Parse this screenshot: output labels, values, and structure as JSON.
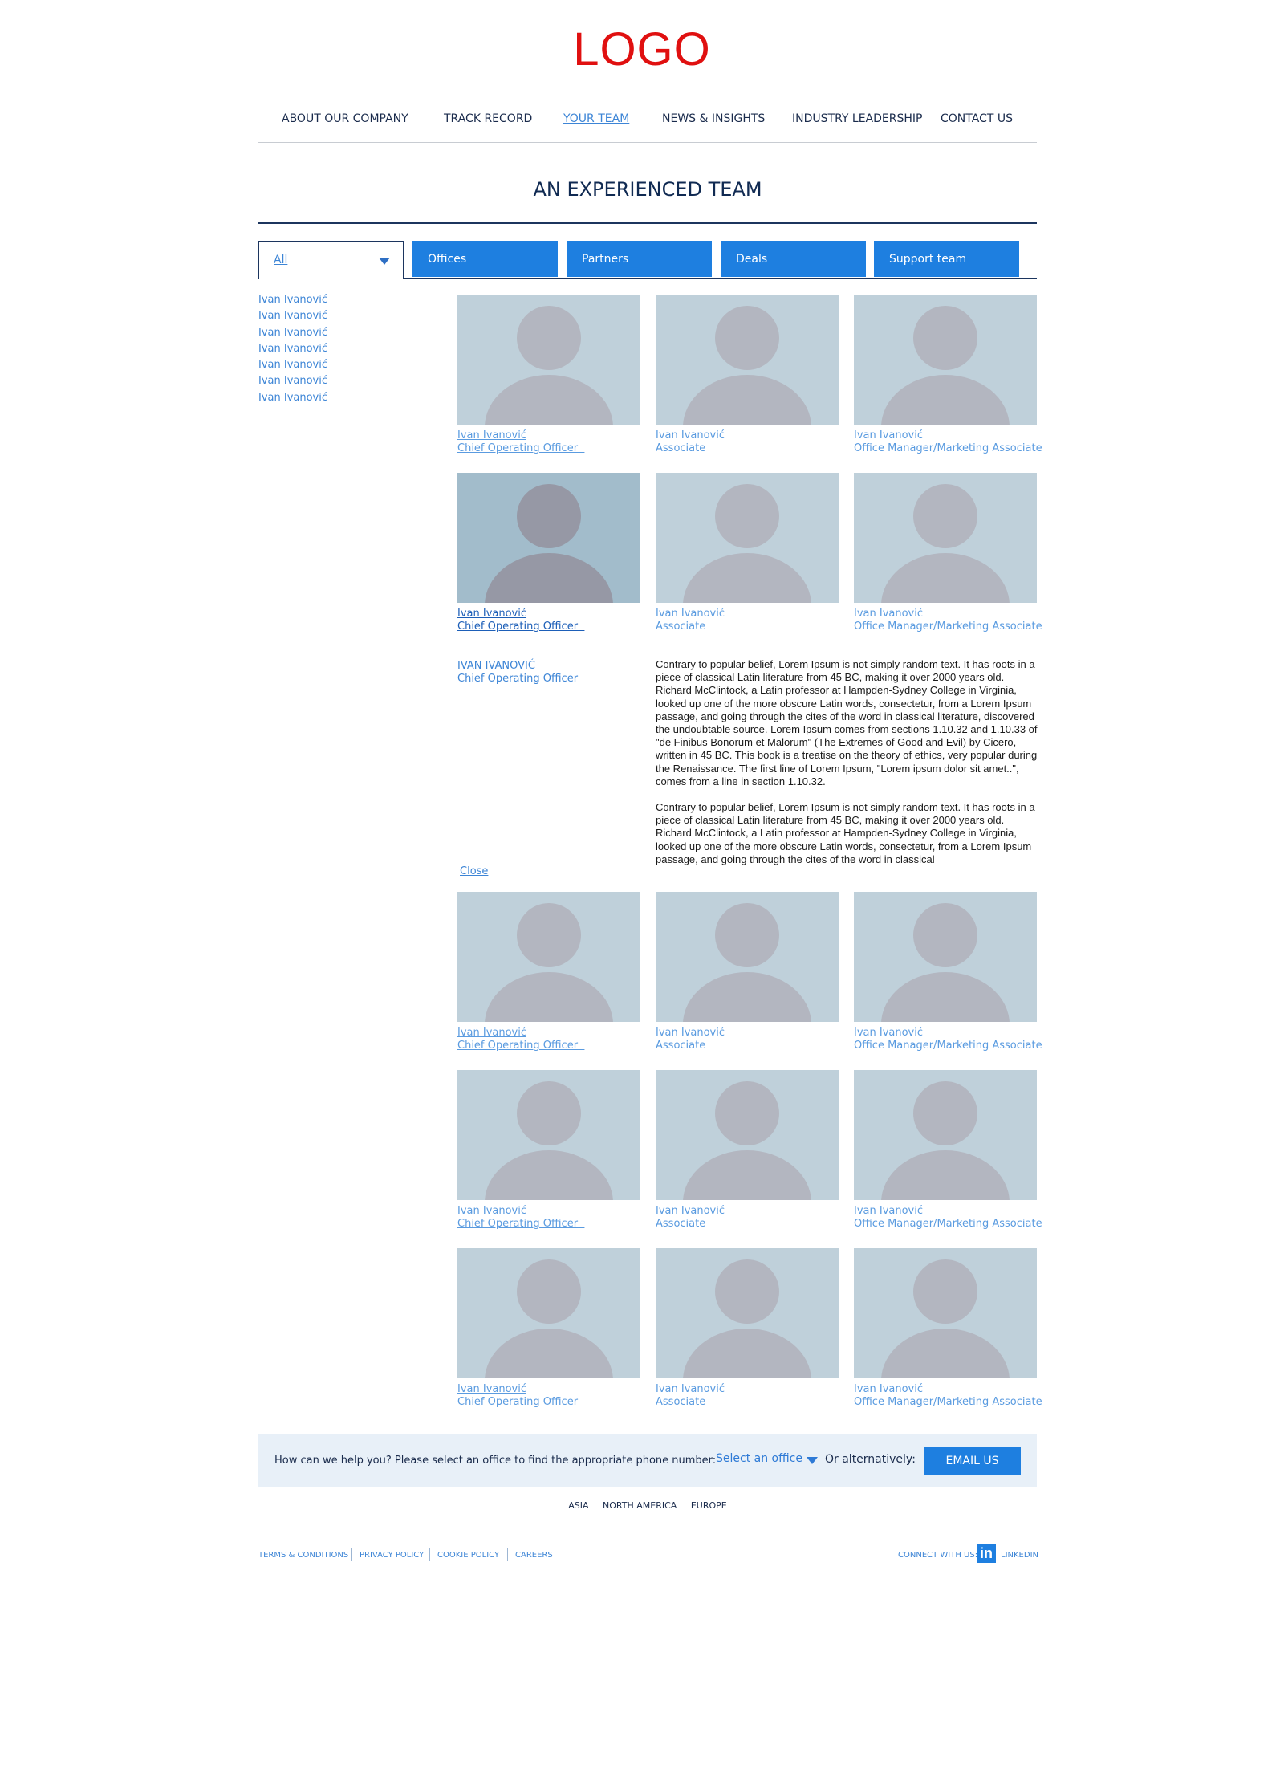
{
  "header": {
    "logo": "LOGO"
  },
  "nav": {
    "items": [
      "ABOUT OUR COMPANY",
      "TRACK RECORD",
      "YOUR TEAM",
      "NEWS & INSIGHTS",
      "INDUSTRY LEADERSHIP",
      "CONTACT US"
    ],
    "active": "YOUR TEAM"
  },
  "page": {
    "title": "AN EXPERIENCED TEAM"
  },
  "filters": {
    "dropdown": {
      "selected": "All"
    },
    "tabs": [
      "Offices",
      "Partners",
      "Deals",
      "Support team"
    ]
  },
  "sidebar": {
    "links": [
      "Ivan Ivanović",
      "Ivan Ivanović",
      "Ivan Ivanović",
      "Ivan Ivanović",
      "Ivan Ivanović",
      "Ivan Ivanović",
      "Ivan Ivanović"
    ]
  },
  "team": {
    "rows": [
      [
        {
          "name": "Ivan Ivanović",
          "role": "Chief Operating Officer"
        },
        {
          "name": "Ivan Ivanović",
          "role": "Associate"
        },
        {
          "name": "Ivan Ivanović",
          "role": "Office Manager/Marketing Associate"
        }
      ],
      [
        {
          "name": "Ivan Ivanović",
          "role": "Chief Operating Officer"
        },
        {
          "name": "Ivan Ivanović",
          "role": "Associate"
        },
        {
          "name": "Ivan Ivanović",
          "role": "Office Manager/Marketing Associate"
        }
      ],
      [
        {
          "name": "Ivan Ivanović",
          "role": "Chief Operating Officer"
        },
        {
          "name": "Ivan Ivanović",
          "role": "Associate"
        },
        {
          "name": "Ivan Ivanović",
          "role": "Office Manager/Marketing Associate"
        }
      ],
      [
        {
          "name": "Ivan Ivanović",
          "role": "Chief Operating Officer"
        },
        {
          "name": "Ivan Ivanović",
          "role": "Associate"
        },
        {
          "name": "Ivan Ivanović",
          "role": "Office Manager/Marketing Associate"
        }
      ],
      [
        {
          "name": "Ivan Ivanović",
          "role": "Chief Operating Officer"
        },
        {
          "name": "Ivan Ivanović",
          "role": "Associate"
        },
        {
          "name": "Ivan Ivanović",
          "role": "Office Manager/Marketing Associate"
        }
      ]
    ]
  },
  "detail": {
    "name": "IVAN IVANOVIĆ",
    "role": "Chief Operating Officer",
    "close_label": "Close",
    "bio": [
      "Contrary to popular belief, Lorem Ipsum is not simply random text. It has roots in a piece of classical Latin literature from 45 BC, making it over 2000 years old. Richard McClintock, a Latin professor at Hampden-Sydney College in Virginia, looked up one of the more obscure Latin words, consectetur, from a Lorem Ipsum passage, and going through the cites of the word in classical literature, discovered the undoubtable source. Lorem Ipsum comes from sections 1.10.32 and 1.10.33 of \"de Finibus Bonorum et Malorum\" (The Extremes of Good and Evil) by Cicero, written in 45 BC. This book is a treatise on the theory of ethics, very popular during the Renaissance. The first line of Lorem Ipsum, \"Lorem ipsum dolor sit amet..\", comes from a line in section 1.10.32.",
      "Contrary to popular belief, Lorem Ipsum is not simply random text. It has roots in a piece of classical Latin literature from 45 BC, making it over 2000 years old. Richard McClintock, a Latin professor at Hampden-Sydney College in Virginia, looked up one of the more obscure Latin words, consectetur, from a Lorem Ipsum passage, and going through the cites of the word in classical"
    ]
  },
  "help": {
    "question": "How can we help you? Please select an office to find the appropriate phone number:",
    "select_placeholder": "Select an office",
    "alternatively": "Or alternatively:",
    "email_button": "EMAIL US"
  },
  "regions": [
    "ASIA",
    "NORTH AMERICA",
    "EUROPE"
  ],
  "footer": {
    "links": [
      "TERMS & CONDITIONS",
      "PRIVACY POLICY",
      "COOKIE POLICY",
      "CAREERS"
    ],
    "connect": "CONNECT WITH US:",
    "linkedin_icon_text": "in",
    "linkedin": "LINKEDIN"
  },
  "colors": {
    "logo": "#e01010",
    "accent": "#1e7fe0",
    "link": "#3d85d6",
    "navy": "#1c355e",
    "photo_bg": "#bfd0da",
    "help_bg": "#e8f0f8"
  }
}
